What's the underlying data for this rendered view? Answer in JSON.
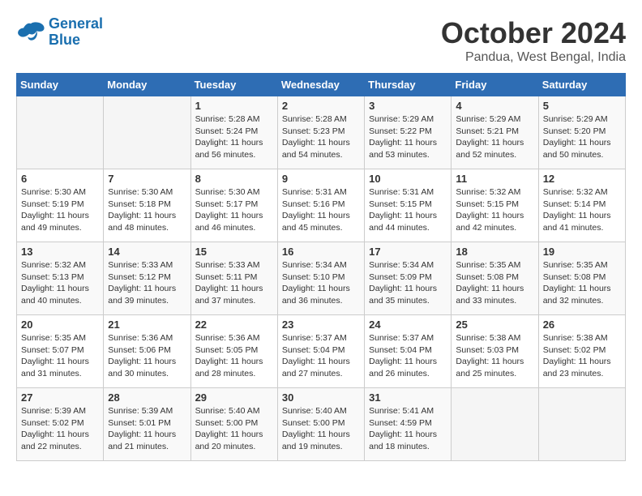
{
  "logo": {
    "line1": "General",
    "line2": "Blue"
  },
  "title": "October 2024",
  "location": "Pandua, West Bengal, India",
  "headers": [
    "Sunday",
    "Monday",
    "Tuesday",
    "Wednesday",
    "Thursday",
    "Friday",
    "Saturday"
  ],
  "weeks": [
    [
      {
        "day": "",
        "info": ""
      },
      {
        "day": "",
        "info": ""
      },
      {
        "day": "1",
        "info": "Sunrise: 5:28 AM\nSunset: 5:24 PM\nDaylight: 11 hours and 56 minutes."
      },
      {
        "day": "2",
        "info": "Sunrise: 5:28 AM\nSunset: 5:23 PM\nDaylight: 11 hours and 54 minutes."
      },
      {
        "day": "3",
        "info": "Sunrise: 5:29 AM\nSunset: 5:22 PM\nDaylight: 11 hours and 53 minutes."
      },
      {
        "day": "4",
        "info": "Sunrise: 5:29 AM\nSunset: 5:21 PM\nDaylight: 11 hours and 52 minutes."
      },
      {
        "day": "5",
        "info": "Sunrise: 5:29 AM\nSunset: 5:20 PM\nDaylight: 11 hours and 50 minutes."
      }
    ],
    [
      {
        "day": "6",
        "info": "Sunrise: 5:30 AM\nSunset: 5:19 PM\nDaylight: 11 hours and 49 minutes."
      },
      {
        "day": "7",
        "info": "Sunrise: 5:30 AM\nSunset: 5:18 PM\nDaylight: 11 hours and 48 minutes."
      },
      {
        "day": "8",
        "info": "Sunrise: 5:30 AM\nSunset: 5:17 PM\nDaylight: 11 hours and 46 minutes."
      },
      {
        "day": "9",
        "info": "Sunrise: 5:31 AM\nSunset: 5:16 PM\nDaylight: 11 hours and 45 minutes."
      },
      {
        "day": "10",
        "info": "Sunrise: 5:31 AM\nSunset: 5:15 PM\nDaylight: 11 hours and 44 minutes."
      },
      {
        "day": "11",
        "info": "Sunrise: 5:32 AM\nSunset: 5:15 PM\nDaylight: 11 hours and 42 minutes."
      },
      {
        "day": "12",
        "info": "Sunrise: 5:32 AM\nSunset: 5:14 PM\nDaylight: 11 hours and 41 minutes."
      }
    ],
    [
      {
        "day": "13",
        "info": "Sunrise: 5:32 AM\nSunset: 5:13 PM\nDaylight: 11 hours and 40 minutes."
      },
      {
        "day": "14",
        "info": "Sunrise: 5:33 AM\nSunset: 5:12 PM\nDaylight: 11 hours and 39 minutes."
      },
      {
        "day": "15",
        "info": "Sunrise: 5:33 AM\nSunset: 5:11 PM\nDaylight: 11 hours and 37 minutes."
      },
      {
        "day": "16",
        "info": "Sunrise: 5:34 AM\nSunset: 5:10 PM\nDaylight: 11 hours and 36 minutes."
      },
      {
        "day": "17",
        "info": "Sunrise: 5:34 AM\nSunset: 5:09 PM\nDaylight: 11 hours and 35 minutes."
      },
      {
        "day": "18",
        "info": "Sunrise: 5:35 AM\nSunset: 5:08 PM\nDaylight: 11 hours and 33 minutes."
      },
      {
        "day": "19",
        "info": "Sunrise: 5:35 AM\nSunset: 5:08 PM\nDaylight: 11 hours and 32 minutes."
      }
    ],
    [
      {
        "day": "20",
        "info": "Sunrise: 5:35 AM\nSunset: 5:07 PM\nDaylight: 11 hours and 31 minutes."
      },
      {
        "day": "21",
        "info": "Sunrise: 5:36 AM\nSunset: 5:06 PM\nDaylight: 11 hours and 30 minutes."
      },
      {
        "day": "22",
        "info": "Sunrise: 5:36 AM\nSunset: 5:05 PM\nDaylight: 11 hours and 28 minutes."
      },
      {
        "day": "23",
        "info": "Sunrise: 5:37 AM\nSunset: 5:04 PM\nDaylight: 11 hours and 27 minutes."
      },
      {
        "day": "24",
        "info": "Sunrise: 5:37 AM\nSunset: 5:04 PM\nDaylight: 11 hours and 26 minutes."
      },
      {
        "day": "25",
        "info": "Sunrise: 5:38 AM\nSunset: 5:03 PM\nDaylight: 11 hours and 25 minutes."
      },
      {
        "day": "26",
        "info": "Sunrise: 5:38 AM\nSunset: 5:02 PM\nDaylight: 11 hours and 23 minutes."
      }
    ],
    [
      {
        "day": "27",
        "info": "Sunrise: 5:39 AM\nSunset: 5:02 PM\nDaylight: 11 hours and 22 minutes."
      },
      {
        "day": "28",
        "info": "Sunrise: 5:39 AM\nSunset: 5:01 PM\nDaylight: 11 hours and 21 minutes."
      },
      {
        "day": "29",
        "info": "Sunrise: 5:40 AM\nSunset: 5:00 PM\nDaylight: 11 hours and 20 minutes."
      },
      {
        "day": "30",
        "info": "Sunrise: 5:40 AM\nSunset: 5:00 PM\nDaylight: 11 hours and 19 minutes."
      },
      {
        "day": "31",
        "info": "Sunrise: 5:41 AM\nSunset: 4:59 PM\nDaylight: 11 hours and 18 minutes."
      },
      {
        "day": "",
        "info": ""
      },
      {
        "day": "",
        "info": ""
      }
    ]
  ]
}
